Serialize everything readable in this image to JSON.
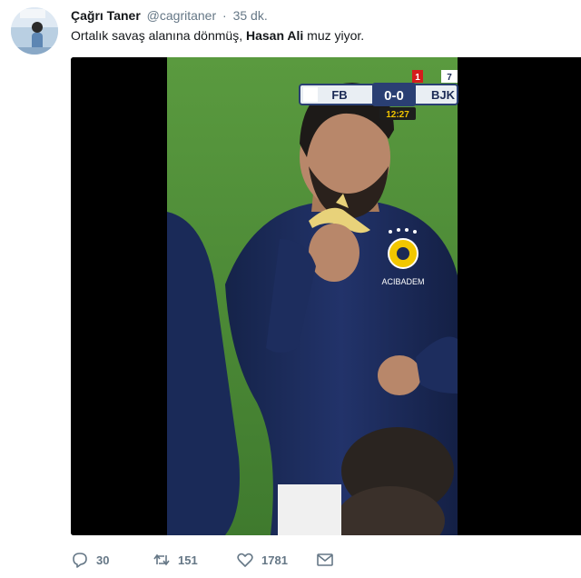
{
  "tweet": {
    "author_name": "Çağrı Taner",
    "author_handle": "@cagritaner",
    "separator": "·",
    "time": "35 dk.",
    "text_prefix": "Ortalık savaş alanına dönmüş, ",
    "text_bold": "Hasan Ali",
    "text_suffix": " muz yiyor.",
    "replies": "30",
    "retweets": "151",
    "likes": "1781"
  },
  "scoreboard": {
    "home": "FB",
    "score": "0-0",
    "away": "BJK",
    "clock": "12:27",
    "red_card": "1",
    "corner_number": "7"
  },
  "sponsor_text": "ACIBADEM",
  "colors": {
    "text_primary": "#14171a",
    "text_secondary": "#657786",
    "pitch": "#4f8f3a",
    "jersey": "#1b2a55"
  },
  "icons": {
    "reply": "reply-icon",
    "retweet": "retweet-icon",
    "like": "heart-icon",
    "dm": "envelope-icon"
  }
}
